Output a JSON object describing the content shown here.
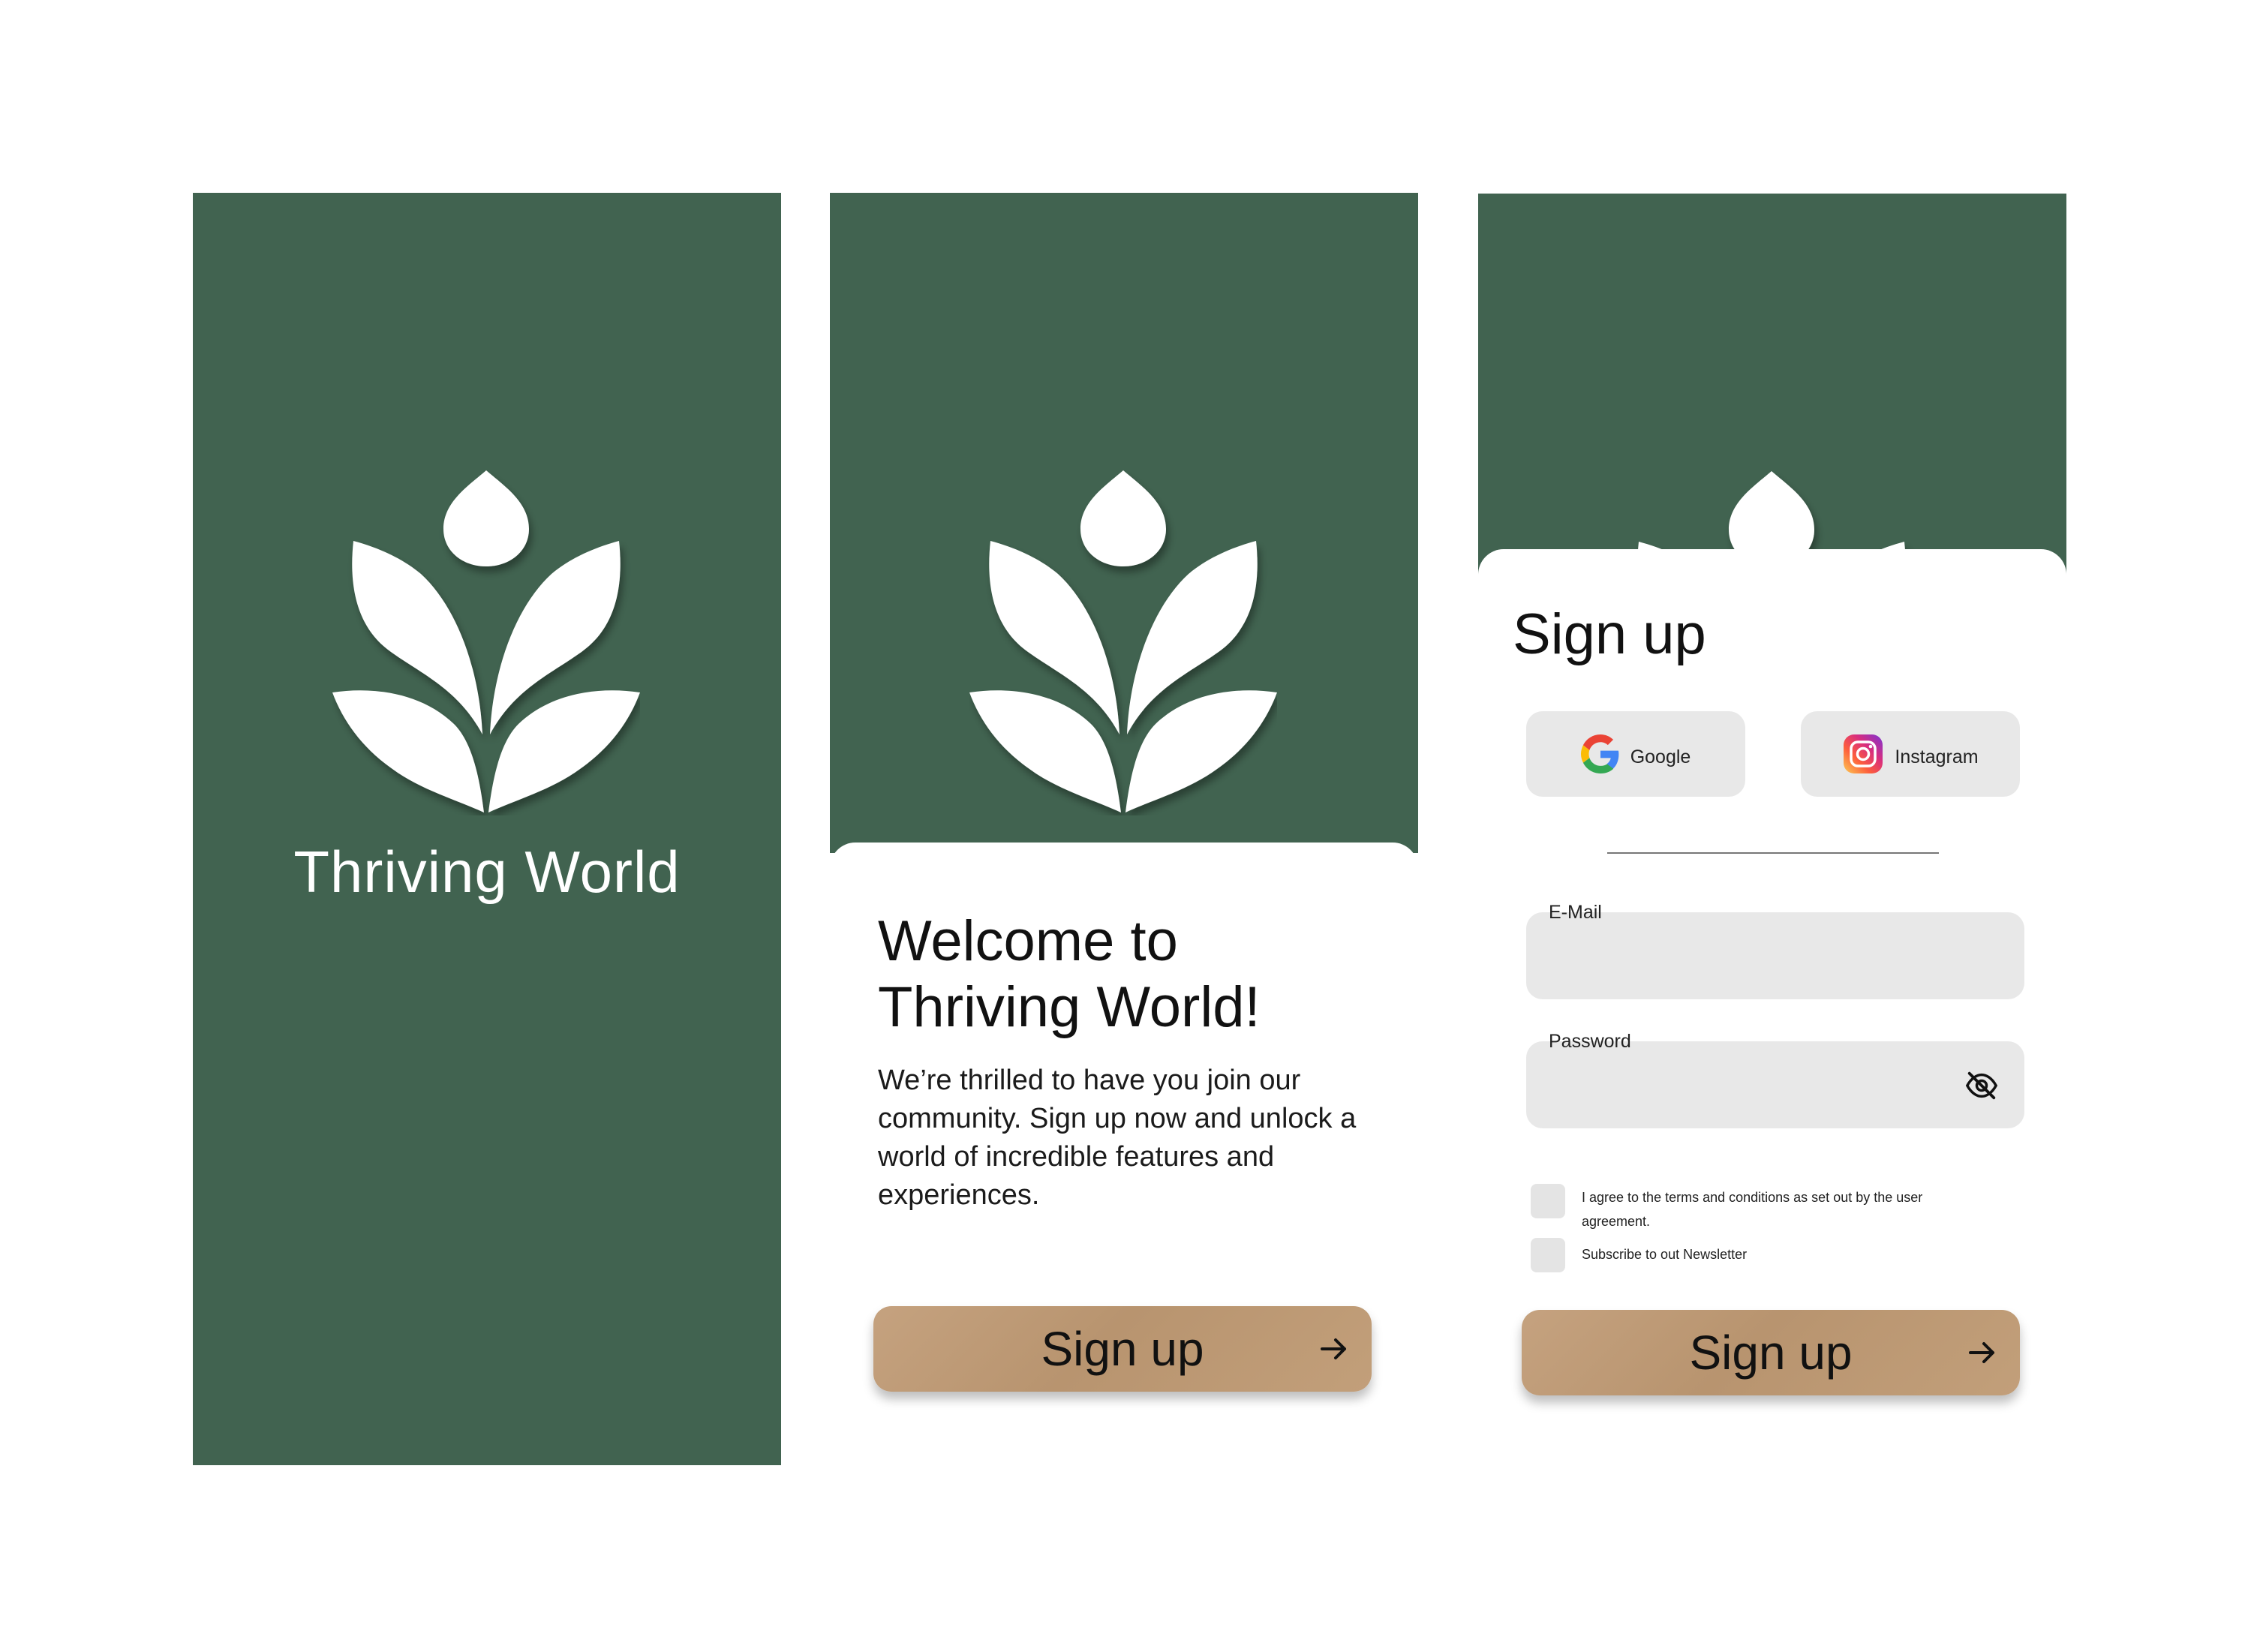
{
  "colors": {
    "brand_green": "#416350",
    "cta_kraft": "#bf9c79",
    "field_gray": "#e8e8e8"
  },
  "splash": {
    "title": "Thriving World",
    "logo_icon": "lotus-leaf-icon"
  },
  "welcome": {
    "heading_line1": "Welcome to",
    "heading_line2": "Thriving World!",
    "body": "We’re thrilled to have you join our community. Sign up now and unlock a world of incredible features and experiences.",
    "cta_label": "Sign up",
    "cta_icon": "arrow-right-icon"
  },
  "signup": {
    "title": "Sign up",
    "social": [
      {
        "label": "Google",
        "icon": "google-icon"
      },
      {
        "label": "Instagram",
        "icon": "instagram-icon"
      }
    ],
    "email_label": "E-Mail",
    "email_value": "",
    "password_label": "Password",
    "password_value": "",
    "password_toggle_icon": "eye-off-icon",
    "agree_text": "I agree to the terms and conditions as set out by the user agreement.",
    "newsletter_text": "Subscribe to out Newsletter",
    "cta_label": "Sign up",
    "cta_icon": "arrow-right-icon"
  }
}
